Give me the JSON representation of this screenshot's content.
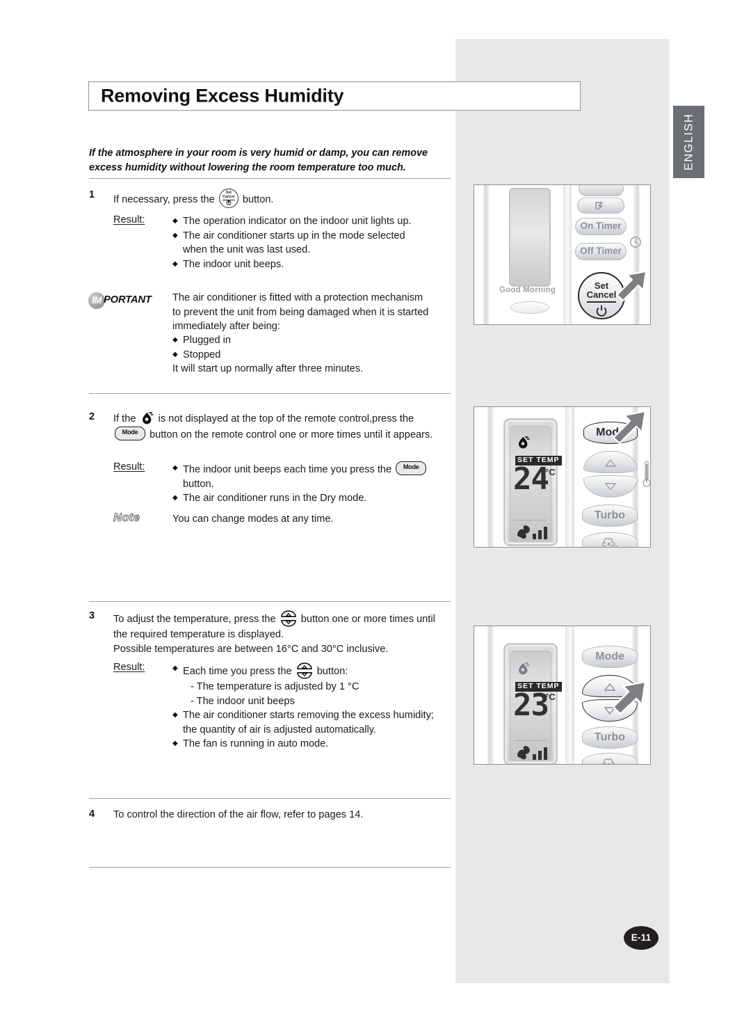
{
  "page": {
    "title": "Removing Excess Humidity",
    "language_tab": "ENGLISH",
    "page_number": "E-11"
  },
  "intro": "If the atmosphere in your room is very humid or damp, you can remove excess humidity without lowering the room temperature too much.",
  "steps": {
    "step1": {
      "number": "1",
      "text_before_icon": "If necessary, press the",
      "icon": "set-cancel-button-icon",
      "text_after_icon": "button.",
      "result_label": "Result:",
      "results": [
        "The operation indicator on the indoor unit lights up.",
        "The air conditioner starts up in the mode selected",
        "when the unit was last used.",
        "The indoor unit beeps."
      ]
    },
    "important": {
      "badge_circle": "IM",
      "badge_rest": "PORTANT",
      "lines": [
        "The air conditioner is fitted with a protection mechanism",
        "to prevent the unit from being damaged when it is started",
        "immediately after being:"
      ],
      "bullets": [
        "Plugged in",
        "Stopped"
      ],
      "closing": "It will start up normally after three minutes."
    },
    "step2": {
      "number": "2",
      "line1_a": "If the",
      "line1_icon": "dry-mode-icon",
      "line1_b": "is not displayed at the top of the remote control,press the",
      "line2_icon": "mode-button-icon",
      "line2_b": "button on the remote control one or more times until it appears.",
      "result_label": "Result:",
      "result1_a": "The indoor unit beeps each time you press the",
      "result1_icon": "mode-button-icon",
      "result1_b": "button.",
      "result2": "The air conditioner runs in the Dry mode.",
      "note_label": "Note",
      "note_text": "You can change modes at any time."
    },
    "step3": {
      "number": "3",
      "line1_a": "To adjust the temperature, press the",
      "line1_icon": "temp-updown-button-icon",
      "line1_b": "button one or more times until",
      "line2": "the required temperature is displayed.",
      "line3": "Possible temperatures are between 16°C and 30°C inclusive.",
      "result_label": "Result:",
      "result1_a": "Each time you press the",
      "result1_icon": "temp-updown-button-icon",
      "result1_b": "button:",
      "sub1": "- The temperature is adjusted by 1 °C",
      "sub2": "- The indoor unit beeps",
      "result2_line1": "The air conditioner starts removing the excess humidity;",
      "result2_line2": "the quantity of air is adjusted automatically.",
      "result3": "The fan is running in auto mode."
    },
    "step4": {
      "number": "4",
      "text": "To control the direction of the air flow, refer to pages 14."
    }
  },
  "figures": {
    "figure1": {
      "good_morning_label": "Good Morning",
      "buttons": [
        "On Timer",
        "Off Timer"
      ],
      "set_cancel_line1": "Set",
      "set_cancel_line2": "Cancel",
      "swing_icon": "air-swing-icon",
      "timer_icon": "clock-icon",
      "cursor": "pointer-arrow"
    },
    "figure2": {
      "mode_button": "Mode",
      "turbo_button": "Turbo",
      "fan_icon": "fan-icon",
      "thermometer_icon": "thermometer-icon",
      "lcd": {
        "dry_icon": "dry-mode-icon",
        "set_temp_label": "SET TEMP",
        "temperature": "24",
        "unit": "°C",
        "fan_speed_icon": "fan-speed-bars-icon"
      },
      "cursor": "pointer-arrow"
    },
    "figure3": {
      "mode_button": "Mode",
      "turbo_button": "Turbo",
      "fan_icon": "fan-icon",
      "lcd": {
        "dry_icon": "dry-mode-icon",
        "set_temp_label": "SET TEMP",
        "temperature": "23",
        "unit": "°C",
        "fan_speed_icon": "fan-speed-bars-icon"
      },
      "cursor": "pointer-arrow"
    }
  },
  "colors": {
    "panel_gray": "#e7e9e9",
    "tab_gray": "#6b6f75",
    "title_border": "#8d93a4",
    "rule": "#9aa3ae",
    "page_badge": "#231f20"
  }
}
